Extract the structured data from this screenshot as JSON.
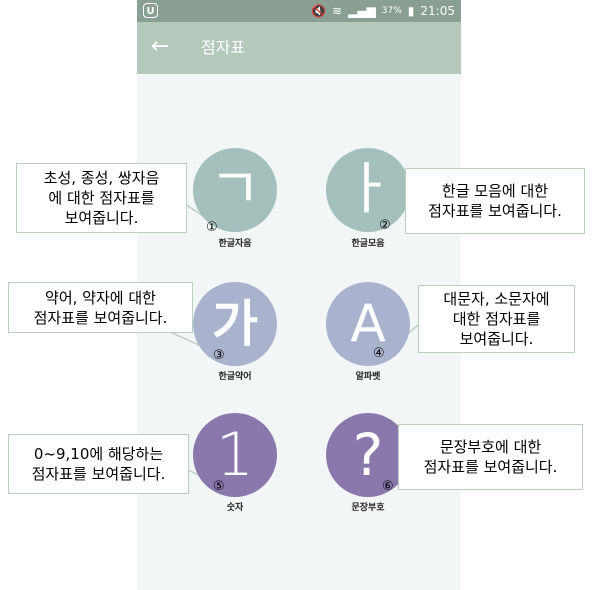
{
  "status_bar": {
    "app_icon": "U",
    "battery": "37%",
    "time": "21:05",
    "icons": [
      "mute-icon",
      "wifi-icon",
      "signal-icon",
      "battery-icon"
    ]
  },
  "app_bar": {
    "back_icon": "←",
    "title": "점자표"
  },
  "tiles": [
    {
      "glyph": "ㄱ",
      "label": "한글자음",
      "number": "①",
      "color": "#a3c0bd"
    },
    {
      "glyph": "ㅏ",
      "label": "한글모음",
      "number": "②",
      "color": "#a3c0bd"
    },
    {
      "glyph": "가",
      "label": "한글약어",
      "number": "③",
      "color": "#a9b3cd"
    },
    {
      "glyph": "A",
      "label": "알파벳",
      "number": "④",
      "color": "#a9b3cd"
    },
    {
      "glyph": "1",
      "label": "숫자",
      "number": "⑤",
      "color": "#8a78ad"
    },
    {
      "glyph": "?",
      "label": "문장부호",
      "number": "⑥",
      "color": "#8a78ad"
    }
  ],
  "callouts": [
    {
      "lines": [
        "초성, 종성, 쌍자음",
        "에 대한 점자표를",
        "보여줍니다."
      ]
    },
    {
      "lines": [
        "한글 모음에 대한",
        "점자표를 보여줍니다."
      ]
    },
    {
      "lines": [
        "약어, 약자에 대한",
        "점자표를 보여줍니다."
      ]
    },
    {
      "lines": [
        "대문자, 소문자에",
        "대한 점자표를",
        "보여줍니다."
      ]
    },
    {
      "lines": [
        "0~9,10에 해당하는",
        "점자표를 보여줍니다."
      ]
    },
    {
      "lines": [
        "문장부호에 대한",
        "점자표를 보여줍니다."
      ]
    }
  ]
}
